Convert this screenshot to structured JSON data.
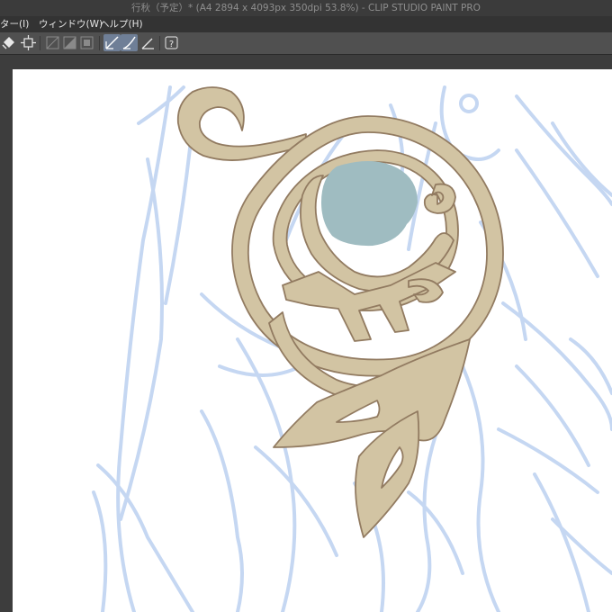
{
  "window": {
    "title": "行秋（予定）* (A4 2894 x 4093px 350dpi 53.8%) - CLIP STUDIO PAINT PRO"
  },
  "menubar": {
    "items": [
      {
        "label": "ター(I)"
      },
      {
        "label": "ウィンドウ(W)"
      },
      {
        "label": "ヘルプ(H)"
      }
    ]
  },
  "toolbar": {
    "icons": [
      "fill-bucket-icon",
      "transform-crop-icon",
      "layer-mask-icon",
      "gradient-fill-icon",
      "frame-icon",
      "ruler-snap-icon",
      "ruler-snap-alt-icon",
      "perspective-ruler-icon",
      "help-icon"
    ],
    "active": [
      "ruler-snap-icon",
      "ruler-snap-alt-icon"
    ]
  },
  "colors": {
    "ornament_fill": "#d2c4a3",
    "ornament_stroke": "#927b61",
    "gem": "#9fbcc1",
    "sketch": "#c5d7f2",
    "canvas": "#ffffff",
    "workspace": "#3d3d3d",
    "toolbar_active": "#6f7f97"
  }
}
